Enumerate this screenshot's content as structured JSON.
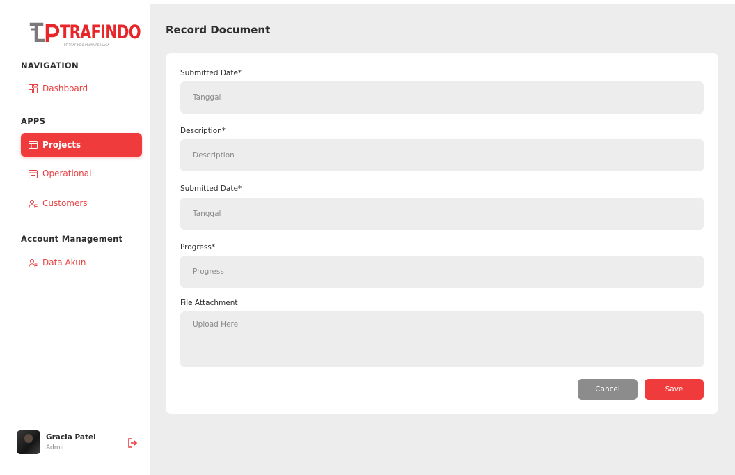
{
  "brand": {
    "name": "TRAFINDO",
    "tagline": "PT TRAFINDO PRIMA PERKASA",
    "color": "#e8262a"
  },
  "sidebar": {
    "sections": [
      {
        "title": "NAVIGATION",
        "items": [
          {
            "label": "Dashboard",
            "icon": "dashboard-grid-icon",
            "active": false
          }
        ]
      },
      {
        "title": "APPS",
        "items": [
          {
            "label": "Projects",
            "icon": "projects-icon",
            "active": true
          },
          {
            "label": "Operational",
            "icon": "calendar-icon",
            "active": false
          },
          {
            "label": "Customers",
            "icon": "users-icon",
            "active": false
          }
        ]
      },
      {
        "title": "Account Management",
        "items": [
          {
            "label": "Data Akun",
            "icon": "users-icon",
            "active": false
          }
        ]
      }
    ],
    "accent": "#ef3b3b"
  },
  "profile": {
    "name": "Gracia Patel",
    "role": "Admin",
    "logout_icon": "logout-icon"
  },
  "main": {
    "title": "Record Document",
    "form": {
      "fields": [
        {
          "label": "Submitted Date*",
          "placeholder": "Tanggal",
          "value": ""
        },
        {
          "label": "Description*",
          "placeholder": "Description",
          "value": ""
        },
        {
          "label": "Submitted Date*",
          "placeholder": "Tanggal",
          "value": ""
        },
        {
          "label": "Progress*",
          "placeholder": "Progress",
          "value": ""
        },
        {
          "label": "File Attachment",
          "placeholder": "Upload Here",
          "value": ""
        }
      ],
      "cancel_label": "Cancel",
      "save_label": "Save"
    }
  }
}
